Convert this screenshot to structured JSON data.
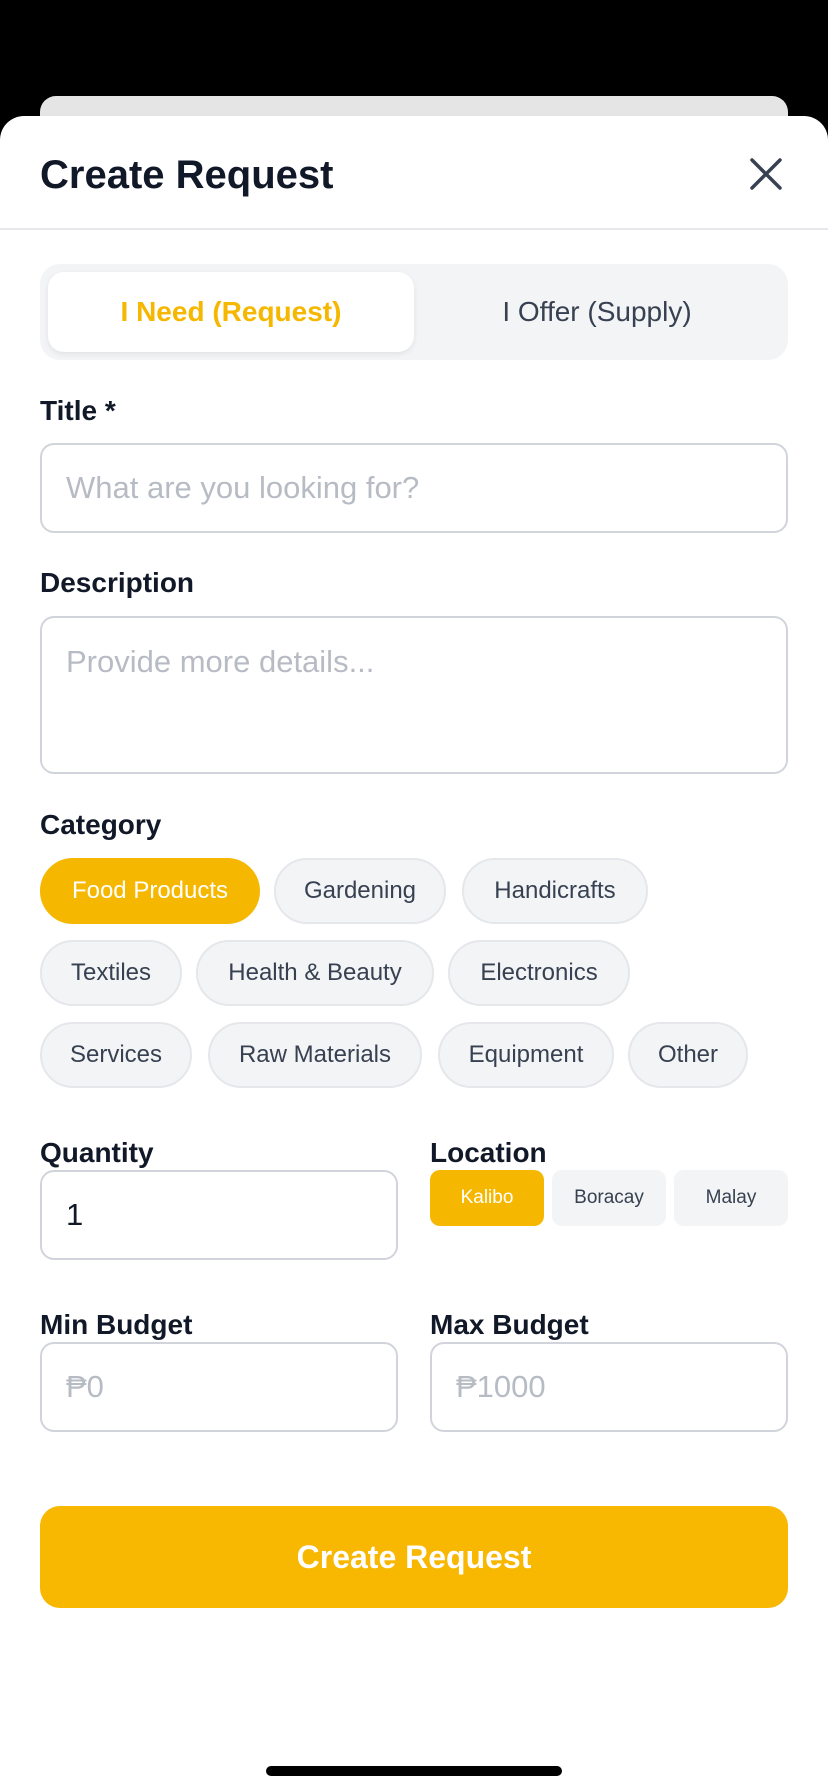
{
  "header": {
    "title": "Create Request"
  },
  "mode_toggle": {
    "options": [
      {
        "label": "I Need (Request)",
        "selected": true
      },
      {
        "label": "I Offer (Supply)",
        "selected": false
      }
    ]
  },
  "form": {
    "title_label": "Title *",
    "title_placeholder": "What are you looking for?",
    "description_label": "Description",
    "description_placeholder": "Provide more details...",
    "category_label": "Category",
    "categories": [
      {
        "label": "Food Products",
        "selected": true
      },
      {
        "label": "Gardening",
        "selected": false
      },
      {
        "label": "Handicrafts",
        "selected": false
      },
      {
        "label": "Textiles",
        "selected": false
      },
      {
        "label": "Health & Beauty",
        "selected": false
      },
      {
        "label": "Electronics",
        "selected": false
      },
      {
        "label": "Services",
        "selected": false
      },
      {
        "label": "Raw Materials",
        "selected": false
      },
      {
        "label": "Equipment",
        "selected": false
      },
      {
        "label": "Other",
        "selected": false
      }
    ],
    "quantity_label": "Quantity",
    "quantity_value": "1",
    "location_label": "Location",
    "locations": [
      {
        "label": "Kalibo",
        "selected": true
      },
      {
        "label": "Boracay",
        "selected": false
      },
      {
        "label": "Malay",
        "selected": false
      }
    ],
    "min_budget_label": "Min Budget",
    "min_budget_placeholder": "₱0",
    "max_budget_label": "Max Budget",
    "max_budget_placeholder": "₱1000",
    "submit_label": "Create Request"
  },
  "colors": {
    "accent": "#f8b700",
    "text": "#111827",
    "muted": "#b7bcc4",
    "chip_bg": "#f3f4f6"
  },
  "icons": {
    "close": "close-icon"
  }
}
